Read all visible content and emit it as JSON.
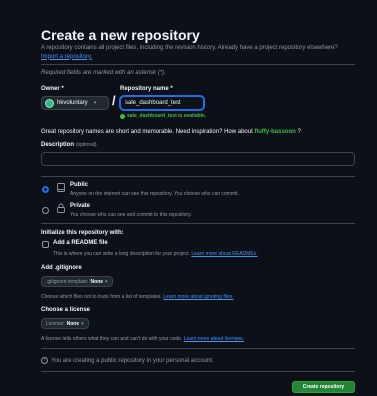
{
  "header": {
    "title": "Create a new repository",
    "intro": "A repository contains all project files, including the revision history. Already have a project repository elsewhere?",
    "import_link": "Import a repository."
  },
  "required_note": "Required fields are marked with an asterisk (*).",
  "owner": {
    "label": "Owner *",
    "value": "hkvoluntary"
  },
  "repository": {
    "label": "Repository name *",
    "value": "sale_dashboard_test",
    "availability": "sale_dashboard_test is available."
  },
  "suggestion": {
    "text": "Great repository names are short and memorable. Need inspiration? How about",
    "name": "fluffy-bassoon",
    "suffix": "?"
  },
  "description": {
    "label": "Description",
    "optional": "(optional)",
    "value": ""
  },
  "visibility": {
    "public": {
      "title": "Public",
      "desc": "Anyone on the internet can see this repository. You choose who can commit.",
      "selected": true
    },
    "private": {
      "title": "Private",
      "desc": "You choose who can see and commit to this repository.",
      "selected": false
    }
  },
  "initialize": {
    "heading": "Initialize this repository with:",
    "readme_label": "Add a README file",
    "readme_desc": "This is where you can write a long description for your project.",
    "readme_link": "Learn more about READMEs."
  },
  "gitignore": {
    "heading": "Add .gitignore",
    "dropdown_prefix": ".gitignore template:",
    "dropdown_value": "None",
    "desc": "Choose which files not to track from a list of templates.",
    "link": "Learn more about ignoring files."
  },
  "license": {
    "heading": "Choose a license",
    "dropdown_prefix": "License:",
    "dropdown_value": "None",
    "desc": "A license tells others what they can and can't do with your code.",
    "link": "Learn more about licenses."
  },
  "notice": "You are creating a public repository in your personal account.",
  "create_button": "Create repository",
  "icons": {
    "info": "i",
    "caret": "▾",
    "check": "✓"
  }
}
